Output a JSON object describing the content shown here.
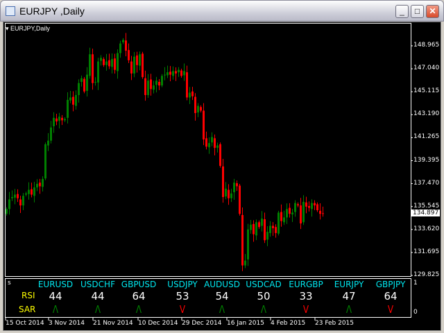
{
  "window": {
    "title": "EURJPY ,Daily",
    "minimize": "_",
    "maximize": "□",
    "close": "✕"
  },
  "chart_label": "▾ EURJPY,Daily",
  "price_axis": [
    "148.965",
    "147.040",
    "145.115",
    "143.190",
    "141.265",
    "139.395",
    "137.470",
    "135.545",
    "133.620",
    "131.695",
    "129.825"
  ],
  "current_price": "134.897",
  "indicator": {
    "corner": "s",
    "scale_top": "1",
    "scale_bottom": "0",
    "rsi_label": "RSI",
    "sar_label": "SAR",
    "pairs": [
      {
        "symbol": "EURUSD",
        "rsi": "44",
        "sar": "Λ",
        "dir": "up"
      },
      {
        "symbol": "USDCHF",
        "rsi": "44",
        "sar": "Λ",
        "dir": "up"
      },
      {
        "symbol": "GBPUSD",
        "rsi": "64",
        "sar": "Λ",
        "dir": "up"
      },
      {
        "symbol": "USDJPY",
        "rsi": "53",
        "sar": "V",
        "dir": "down"
      },
      {
        "symbol": "AUDUSD",
        "rsi": "54",
        "sar": "Λ",
        "dir": "up"
      },
      {
        "symbol": "USDCAD",
        "rsi": "50",
        "sar": "Λ",
        "dir": "up"
      },
      {
        "symbol": "EURGBP",
        "rsi": "33",
        "sar": "V",
        "dir": "down"
      },
      {
        "symbol": "EURJPY",
        "rsi": "47",
        "sar": "Λ",
        "dir": "up"
      },
      {
        "symbol": "GBPJPY",
        "rsi": "64",
        "sar": "V",
        "dir": "down"
      }
    ]
  },
  "dates": [
    "15 Oct 2014",
    "3 Nov 2014",
    "21 Nov 2014",
    "10 Dec 2014",
    "29 Dec 2014",
    "16 Jan 2015",
    "4 Feb 2015",
    "23 Feb 2015"
  ],
  "colors": {
    "up": "#008000",
    "down": "#ff0000",
    "sar_up": "#008000",
    "sar_down": "#ff0000"
  },
  "chart_data": {
    "type": "candlestick",
    "symbol": "EURJPY",
    "timeframe": "Daily",
    "ylim": [
      129.825,
      150.2
    ],
    "close": [
      135.3,
      136.1,
      136.3,
      136.5,
      136.2,
      135.6,
      136.4,
      136.6,
      136.9,
      136.5,
      137.1,
      137.4,
      137.2,
      137.8,
      140.7,
      141.0,
      142.1,
      142.9,
      142.6,
      143.0,
      142.7,
      142.8,
      144.4,
      144.6,
      144.0,
      144.8,
      145.8,
      146.2,
      145.1,
      146.5,
      148.2,
      145.8,
      145.9,
      147.6,
      147.9,
      147.3,
      147.6,
      147.2,
      147.8,
      146.9,
      148.3,
      149.1,
      149.4,
      148.5,
      147.7,
      146.6,
      148.0,
      147.3,
      148.2,
      146.3,
      144.8,
      146.0,
      145.3,
      145.6,
      146.0,
      145.6,
      146.4,
      146.5,
      146.7,
      146.5,
      146.8,
      146.6,
      146.9,
      146.4,
      146.8,
      144.6,
      145.0,
      144.7,
      143.3,
      143.9,
      143.5,
      141.1,
      140.5,
      140.8,
      141.3,
      140.4,
      140.6,
      138.9,
      136.3,
      137.0,
      136.2,
      136.6,
      137.5,
      137.2,
      134.9,
      130.6,
      131.0,
      133.6,
      134.0,
      133.2,
      134.2,
      133.8,
      134.5,
      132.7,
      133.4,
      133.9,
      133.7,
      133.3,
      135.0,
      134.3,
      134.6,
      135.3,
      134.9,
      135.0,
      135.8,
      135.6,
      134.1,
      135.9,
      135.5,
      135.4,
      135.8,
      135.6,
      135.2,
      134.9,
      134.897
    ]
  }
}
